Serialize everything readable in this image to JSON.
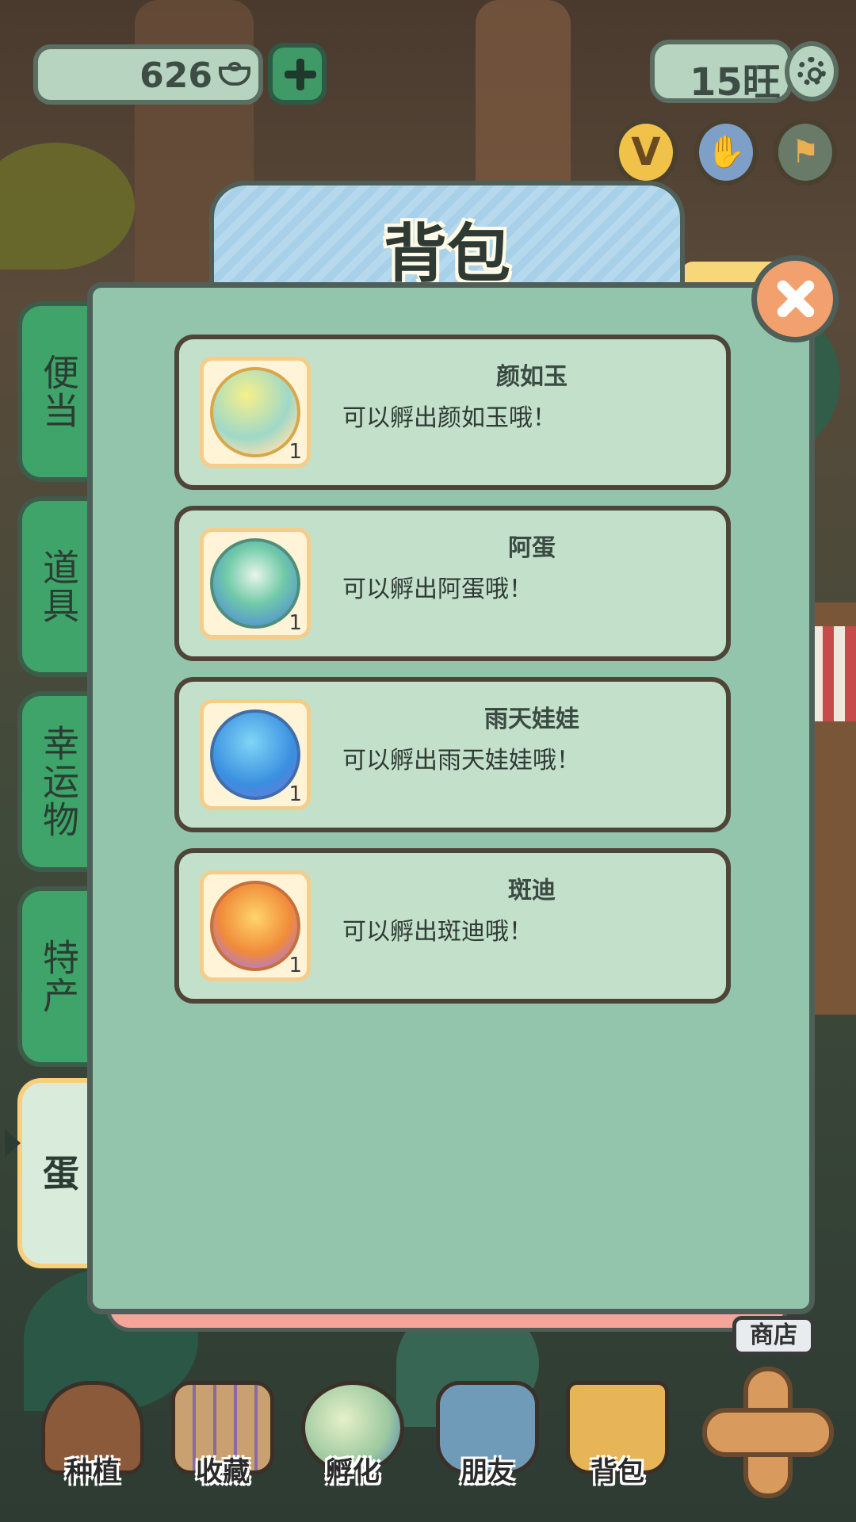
{
  "top_bar": {
    "coins": "626",
    "wang": "15旺"
  },
  "panel": {
    "title": "背包"
  },
  "side_tabs": [
    {
      "label": "便当",
      "active": false
    },
    {
      "label": "道具",
      "active": false
    },
    {
      "label": "幸运物",
      "active": false
    },
    {
      "label": "特产",
      "active": false
    },
    {
      "label": "蛋",
      "active": true
    }
  ],
  "items": [
    {
      "name": "颜如玉",
      "desc": "可以孵出颜如玉哦！",
      "count": "1",
      "icon": "egg-yanruyu-icon"
    },
    {
      "name": "阿蛋",
      "desc": "可以孵出阿蛋哦！",
      "count": "1",
      "icon": "egg-adan-icon"
    },
    {
      "name": "雨天娃娃",
      "desc": "可以孵出雨天娃娃哦！",
      "count": "1",
      "icon": "egg-yutianwawa-icon"
    },
    {
      "name": "斑迪",
      "desc": "可以孵出斑迪哦！",
      "count": "1",
      "icon": "egg-bandi-icon"
    }
  ],
  "bottom_nav": [
    {
      "label": "种植",
      "icon": "planting-icon"
    },
    {
      "label": "收藏",
      "icon": "collection-book-icon"
    },
    {
      "label": "孵化",
      "icon": "hatch-egg-icon"
    },
    {
      "label": "朋友",
      "icon": "friend-cat-icon"
    },
    {
      "label": "背包",
      "icon": "backpack-basket-icon"
    }
  ],
  "shop_label": "商店",
  "colors": {
    "panel_bg": "#93c5ad",
    "tab_green": "#3ea469",
    "card_bg": "#c3e0cb",
    "close_orange": "#f1a06e",
    "title_blue": "#a8d0e8"
  }
}
